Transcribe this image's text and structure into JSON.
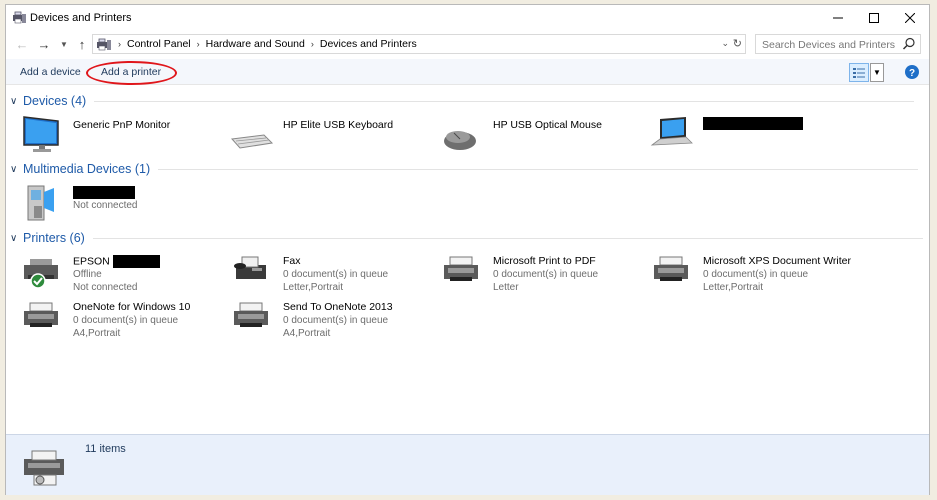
{
  "window": {
    "title": "Devices and Printers"
  },
  "address": {
    "crumbs": [
      "Control Panel",
      "Hardware and Sound",
      "Devices and Printers"
    ],
    "search_placeholder": "Search Devices and Printers"
  },
  "commands": {
    "add_device": "Add a device",
    "add_printer": "Add a printer"
  },
  "colors": {
    "accent": "#1e5aa8",
    "highlight_circle": "#e0161b",
    "details_pane": "#e9f0fb"
  },
  "groups": {
    "devices": {
      "title": "Devices (4)",
      "items": [
        {
          "icon": "monitor-icon",
          "name": "Generic PnP Monitor"
        },
        {
          "icon": "keyboard-icon",
          "name": "HP Elite USB Keyboard"
        },
        {
          "icon": "mouse-icon",
          "name": "HP USB Optical Mouse"
        },
        {
          "icon": "laptop-icon",
          "name": ""
        }
      ]
    },
    "multimedia": {
      "title": "Multimedia Devices (1)",
      "items": [
        {
          "icon": "media-device-icon",
          "name": "",
          "status": "Not connected"
        }
      ]
    },
    "printers": {
      "title": "Printers (6)",
      "items": [
        {
          "icon": "printer-default-icon",
          "name": "EPSON",
          "line2": "Offline",
          "line3": "Not connected"
        },
        {
          "icon": "fax-icon",
          "name": "Fax",
          "line2": "0 document(s) in queue",
          "line3": "Letter,Portrait"
        },
        {
          "icon": "printer-icon",
          "name": "Microsoft Print to PDF",
          "line2": "0 document(s) in queue",
          "line3": "Letter"
        },
        {
          "icon": "printer-icon",
          "name": "Microsoft XPS Document Writer",
          "line2": "0 document(s) in queue",
          "line3": "Letter,Portrait"
        },
        {
          "icon": "printer-icon",
          "name": "OneNote for Windows 10",
          "line2": "0 document(s) in queue",
          "line3": "A4,Portrait"
        },
        {
          "icon": "printer-icon",
          "name": "Send To OneNote 2013",
          "line2": "0 document(s) in queue",
          "line3": "A4,Portrait"
        }
      ]
    }
  },
  "status": {
    "item_count": "11 items"
  }
}
